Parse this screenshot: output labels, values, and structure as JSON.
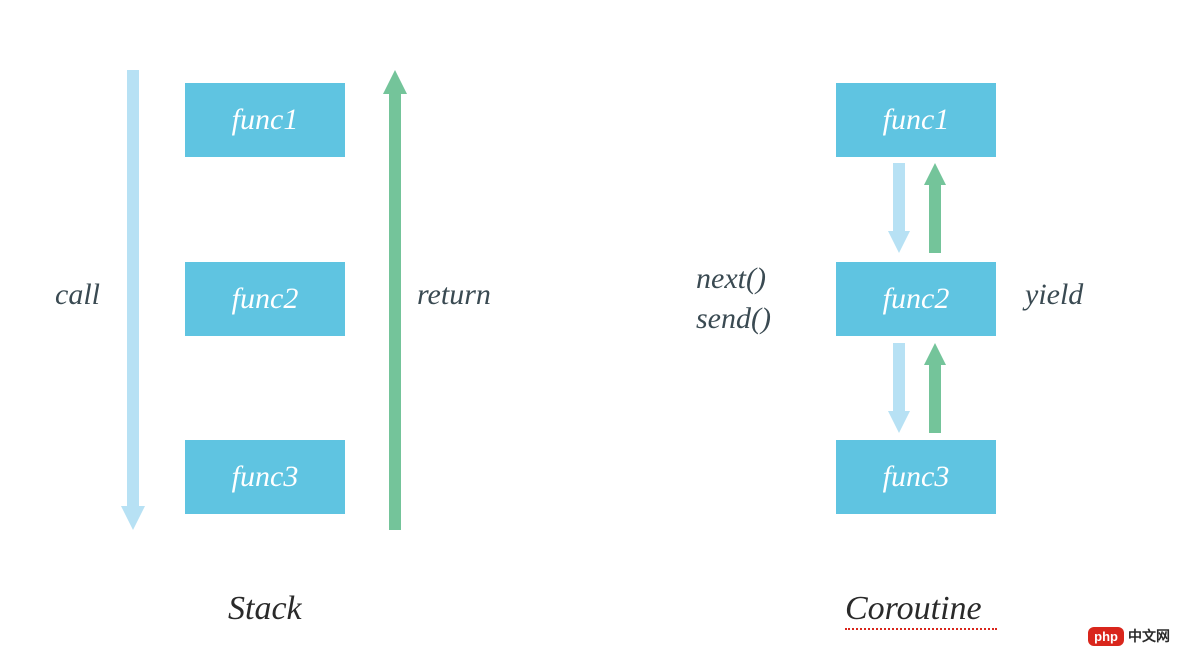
{
  "colors": {
    "box": "#5fc4e1",
    "arrowDown": "#b7e1f4",
    "arrowUp": "#74c49a",
    "text": "#3a4a52"
  },
  "stack": {
    "title": "Stack",
    "boxes": [
      "func1",
      "func2",
      "func3"
    ],
    "leftLabel": "call",
    "rightLabel": "return"
  },
  "coroutine": {
    "title": "Coroutine",
    "boxes": [
      "func1",
      "func2",
      "func3"
    ],
    "leftLabelTop": "next()",
    "leftLabelBottom": "send()",
    "rightLabel": "yield"
  },
  "watermark": {
    "badge": "php",
    "text": "中文网"
  }
}
